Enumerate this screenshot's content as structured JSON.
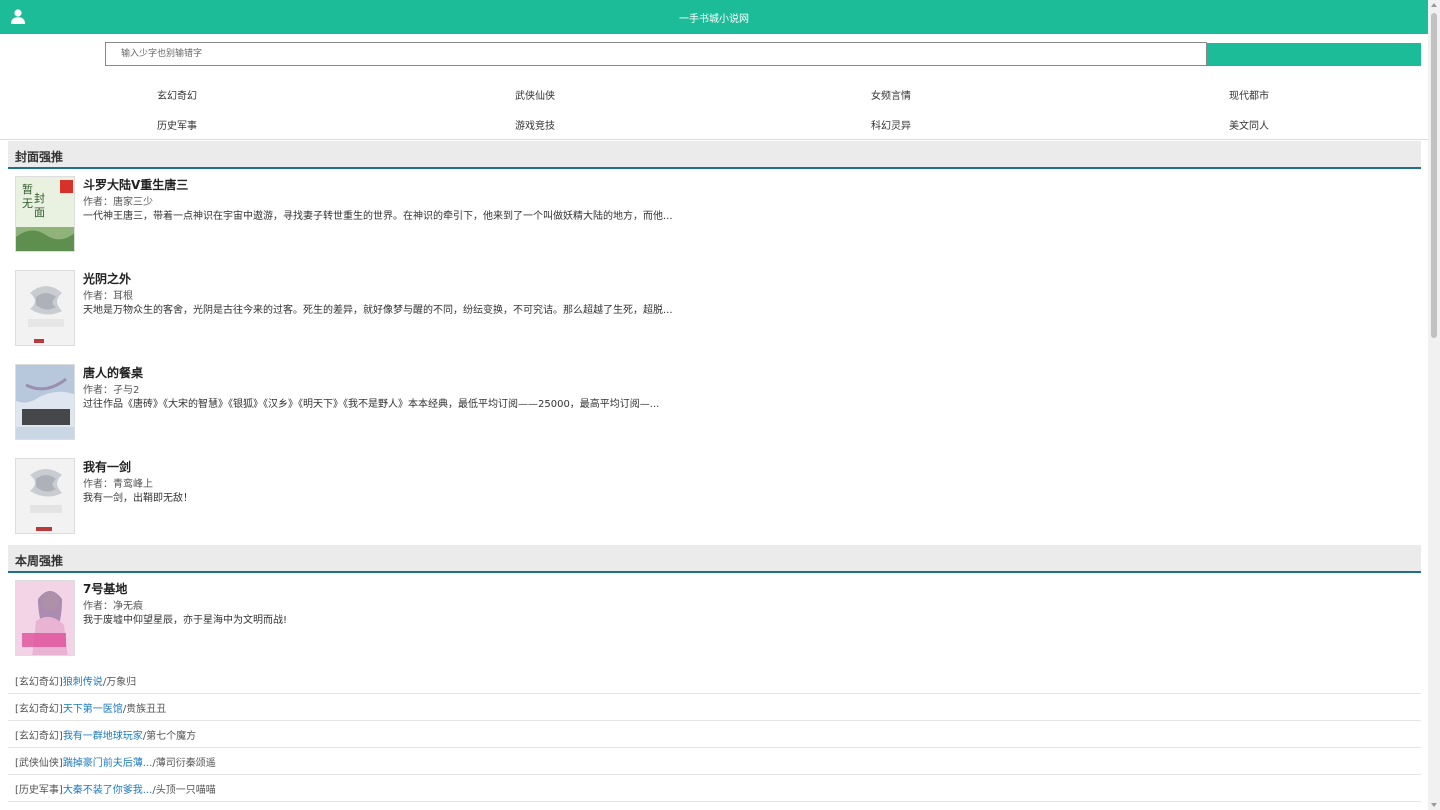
{
  "header": {
    "site_title": "一手书城小说网",
    "user_icon": "user-icon",
    "bg_color": "#1cbc98"
  },
  "search": {
    "placeholder": "输入少字也别输错字",
    "button_label": "",
    "search_icon": "search-icon"
  },
  "categories": [
    "玄幻奇幻",
    "武侠仙侠",
    "女频言情",
    "现代都市",
    "历史军事",
    "游戏竞技",
    "科幻灵异",
    "美文同人"
  ],
  "cover_section": {
    "title": "封面强推",
    "books": [
      {
        "title": "斗罗大陆V重生唐三",
        "author": "作者：唐家三少",
        "desc": "一代神王唐三，带着一点神识在宇宙中遨游，寻找妻子转世重生的世界。在神识的牵引下，他来到了一个叫做妖精大陆的地方，而他..."
      },
      {
        "title": "光阴之外",
        "author": "作者：耳根",
        "desc": "天地是万物众生的客舍，光阴是古往今来的过客。死生的差异，就好像梦与醒的不同，纷纭变换，不可究诘。那么超越了生死，超脱..."
      },
      {
        "title": "唐人的餐桌",
        "author": "作者：孑与2",
        "desc": "过往作品《唐砖》《大宋的智慧》《银狐》《汉乡》《明天下》《我不是野人》本本经典，最低平均订阅——25000，最高平均订阅—..."
      },
      {
        "title": "我有一剑",
        "author": "作者：青鸾峰上",
        "desc": "我有一剑，出鞘即无敌！"
      }
    ]
  },
  "weekly_section": {
    "title": "本周强推",
    "featured": {
      "title": "7号基地",
      "author": "作者：净无痕",
      "desc": "我于废墟中仰望星辰，亦于星海中为文明而战!"
    },
    "list": [
      {
        "cat": "[玄幻奇幻]",
        "title": "狼刺传说",
        "author": "/万象归"
      },
      {
        "cat": "[玄幻奇幻]",
        "title": "天下第一医馆",
        "author": "/贵族丑丑"
      },
      {
        "cat": "[玄幻奇幻]",
        "title": "我有一群地球玩家",
        "author": "/第七个魔方"
      },
      {
        "cat": "[武侠仙侠]",
        "title": "踹掉豪门前夫后薄...",
        "author": "/薄司衍秦颂遥"
      },
      {
        "cat": "[历史军事]",
        "title": "大秦不装了你爹我...",
        "author": "/头顶一只喵喵"
      }
    ]
  }
}
